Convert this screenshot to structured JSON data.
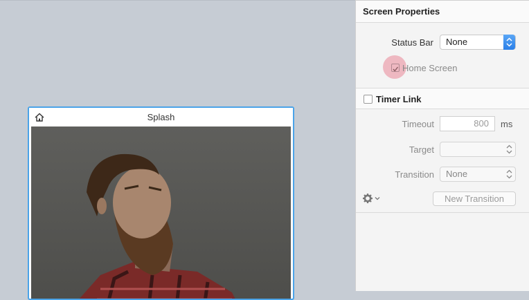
{
  "canvas": {
    "screen_title": "Splash"
  },
  "panel": {
    "header": "Screen Properties",
    "status_bar": {
      "label": "Status Bar",
      "value": "None"
    },
    "home_screen": {
      "label": "Home Screen",
      "checked": true
    },
    "timer_link": {
      "label": "Timer Link",
      "checked": false,
      "timeout": {
        "label": "Timeout",
        "value": "800",
        "unit": "ms"
      },
      "target": {
        "label": "Target",
        "value": ""
      },
      "transition": {
        "label": "Transition",
        "value": "None"
      },
      "new_transition_label": "New Transition"
    }
  },
  "colors": {
    "selection_border": "#4aa3e8",
    "select_accent": "#2a7fe8",
    "highlight": "#e66e82"
  },
  "icons": {
    "home": "home-icon",
    "gear": "gear-icon",
    "chevron": "chevron-down-icon",
    "updown": "updown-arrows-icon"
  }
}
